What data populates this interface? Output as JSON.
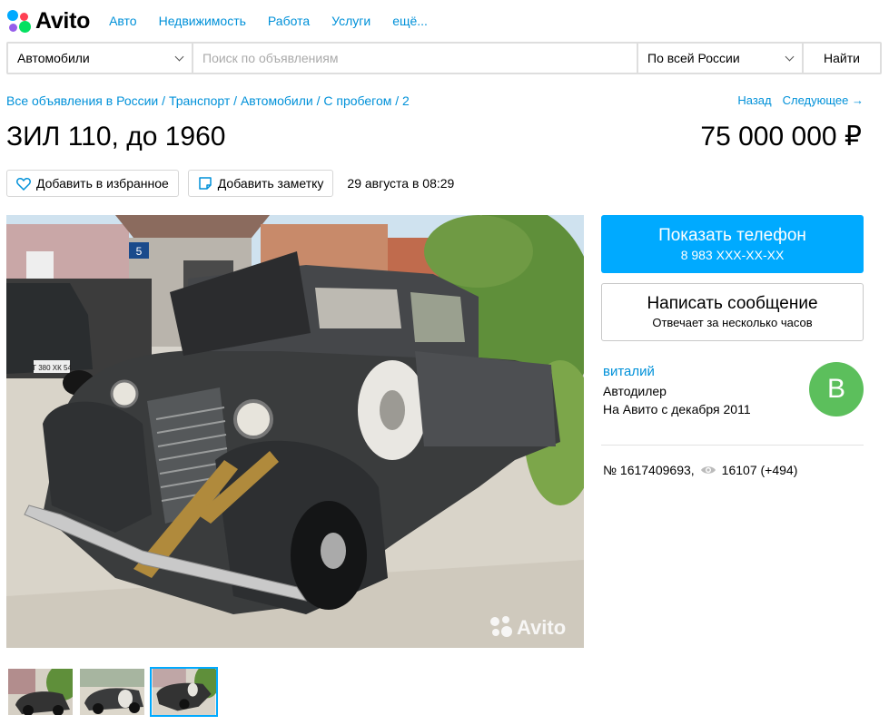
{
  "logo": {
    "text": "Avito"
  },
  "nav": [
    "Авто",
    "Недвижимость",
    "Работа",
    "Услуги",
    "ещё..."
  ],
  "search": {
    "category": "Автомобили",
    "placeholder": "Поиск по объявлениям",
    "region": "По всей России",
    "button": "Найти"
  },
  "breadcrumbs": [
    "Все объявления в России",
    "Транспорт",
    "Автомобили",
    "С пробегом",
    "2"
  ],
  "pager": {
    "back": "Назад",
    "next": "Следующее →"
  },
  "listing": {
    "title": "ЗИЛ 110, до 1960",
    "price": "75 000 000 ₽",
    "favorite_label": "Добавить в избранное",
    "note_label": "Добавить заметку",
    "date": "29 августа в 08:29",
    "photo_watermark": "Avito",
    "photo_house_number": "5",
    "photo_plate": "Т 380 ХК 54"
  },
  "contact": {
    "phone_title": "Показать телефон",
    "phone_number": "8 983 XXX-XX-XX",
    "message_title": "Написать сообщение",
    "message_sub": "Отвечает за несколько часов"
  },
  "seller": {
    "name": "виталий",
    "type": "Автодилер",
    "since": "На Авито с декабря 2011",
    "avatar_letter": "В",
    "avatar_color": "#5cbf5c"
  },
  "meta": {
    "number": "№ 1617409693,",
    "views": "16107 (+494)"
  },
  "colors": {
    "accent": "#00aaff",
    "link": "#0091d9"
  }
}
